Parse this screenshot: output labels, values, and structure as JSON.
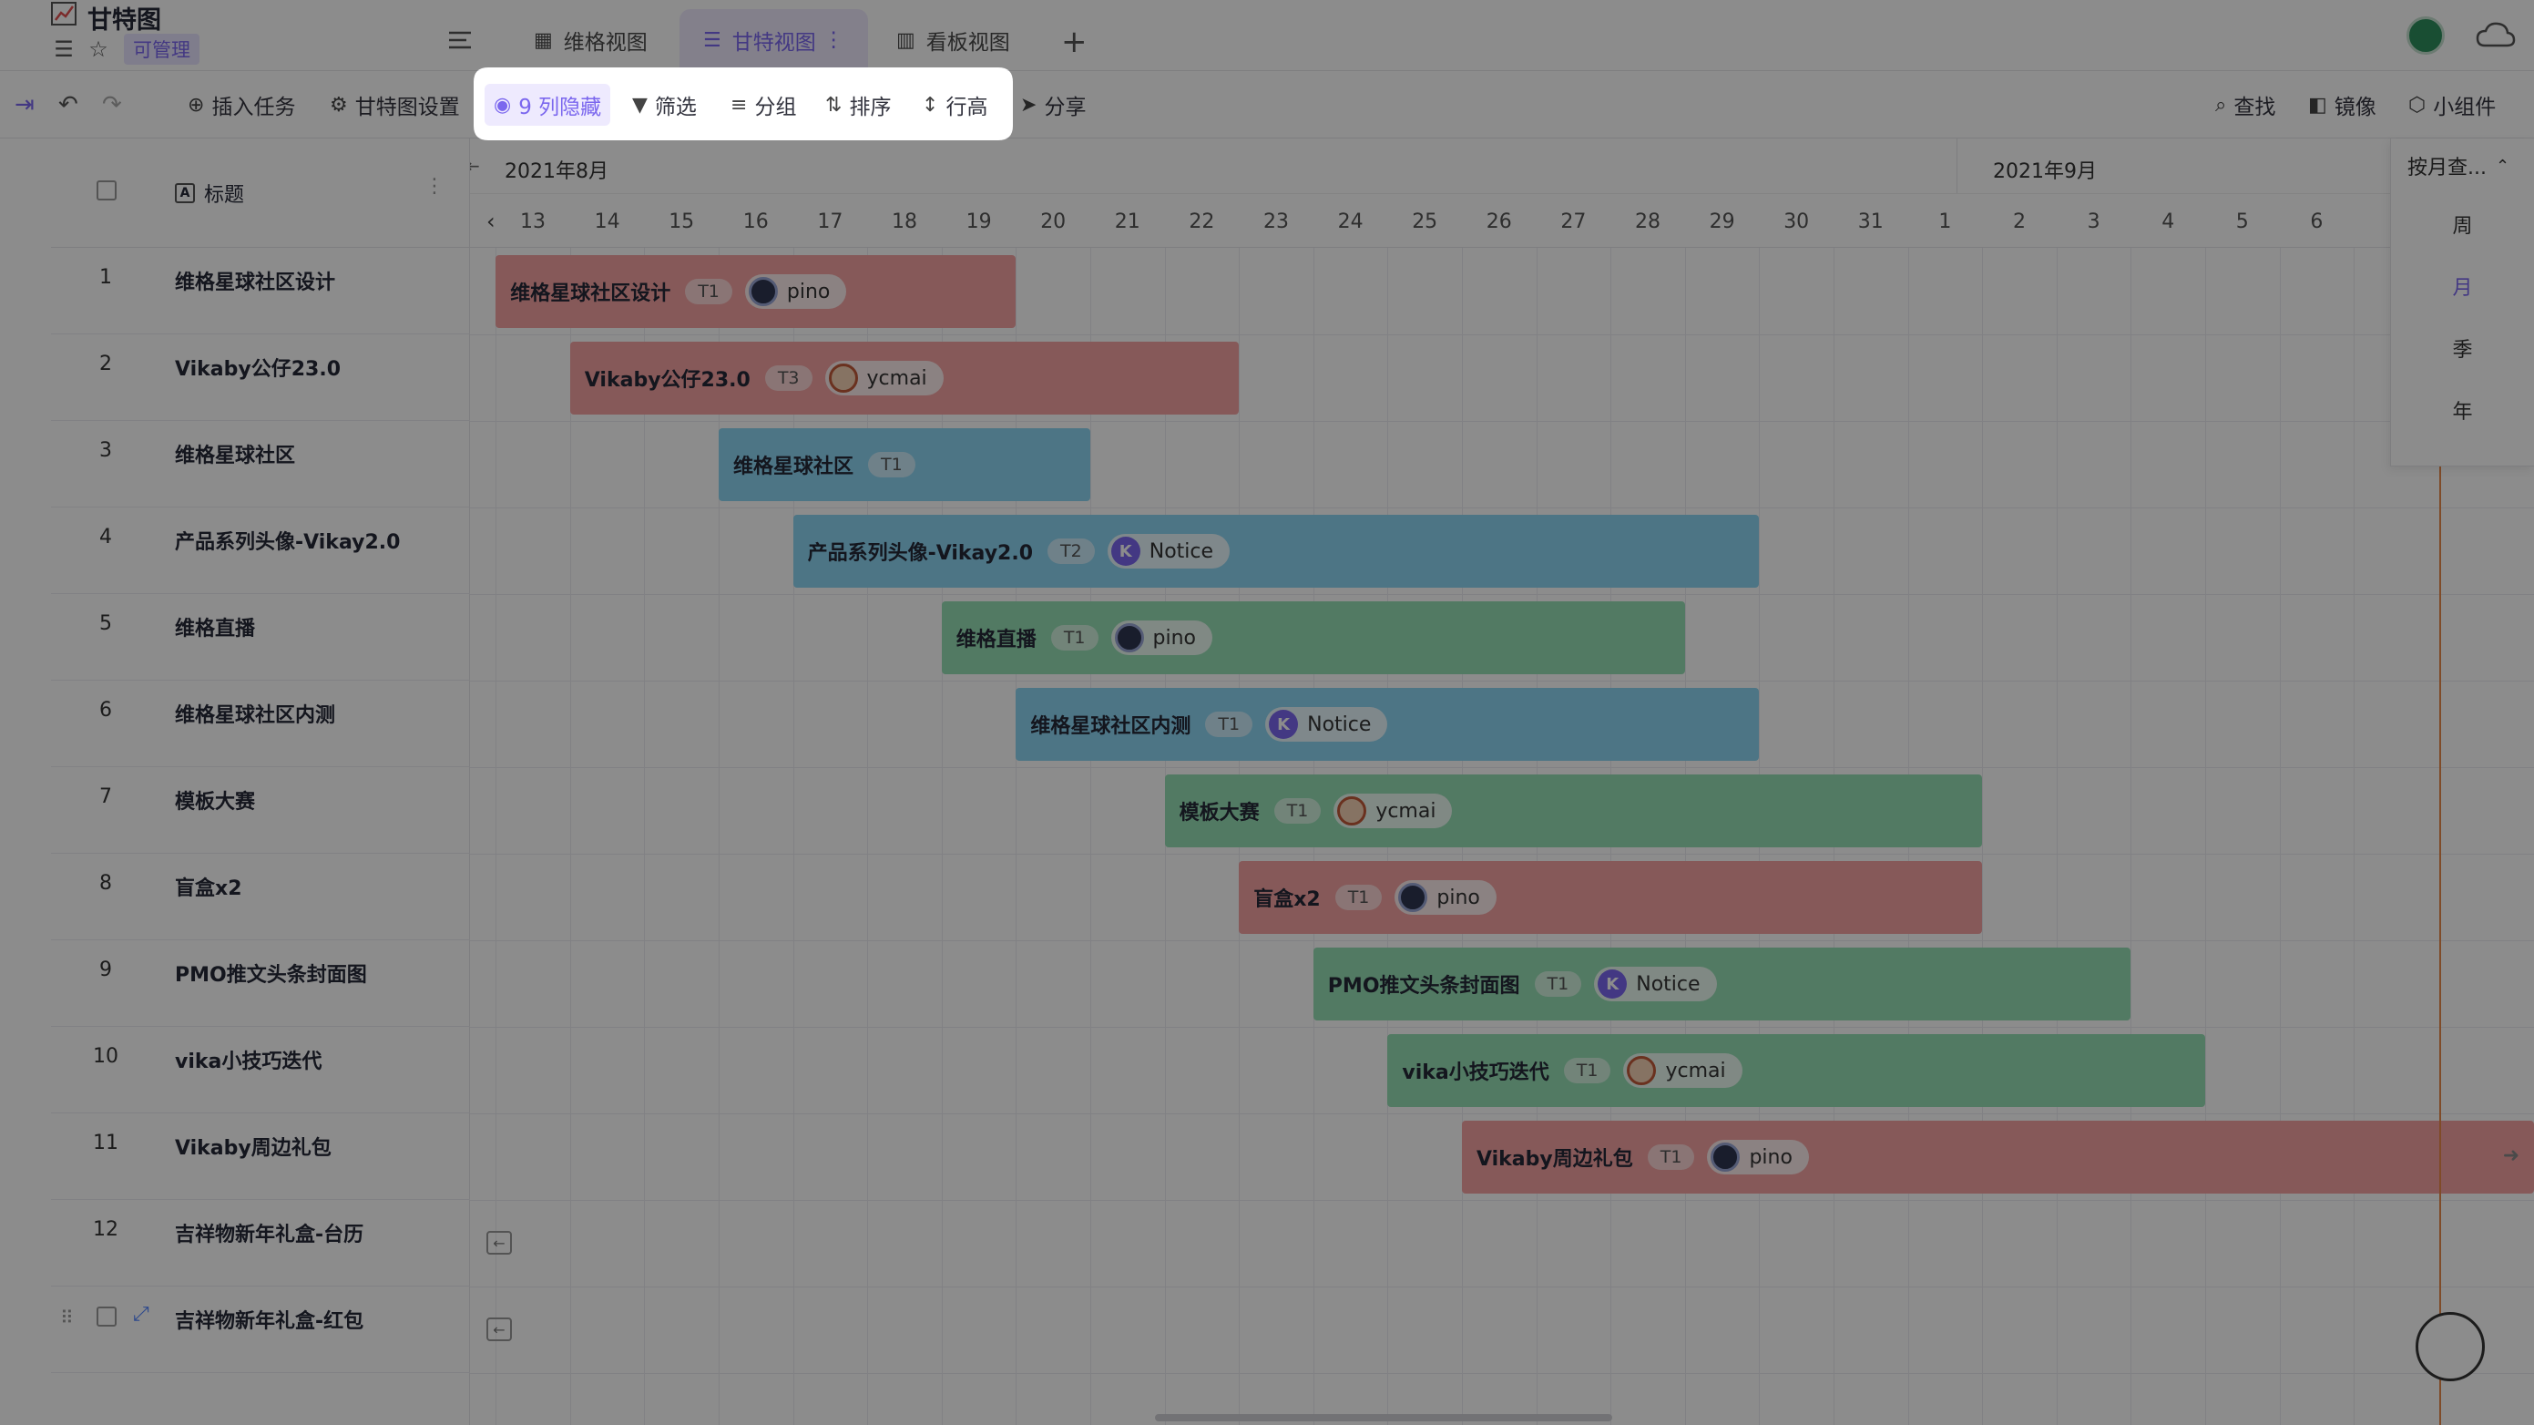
{
  "header": {
    "title": "甘特图",
    "permission_badge": "可管理",
    "tabs": [
      {
        "label": "维格视图",
        "icon": "grid-view-icon"
      },
      {
        "label": "甘特视图",
        "icon": "gantt-view-icon"
      },
      {
        "label": "看板视图",
        "icon": "kanban-view-icon"
      }
    ],
    "add_tab": "+"
  },
  "toolbar": {
    "insert_task": "插入任务",
    "gantt_settings": "甘特图设置",
    "hidden_columns": "9 列隐藏",
    "filter": "筛选",
    "group": "分组",
    "sort": "排序",
    "row_height": "行高",
    "share": "分享",
    "find": "查找",
    "mirror": "镜像",
    "widgets": "小组件"
  },
  "grid": {
    "column_title": "标题",
    "rows": [
      {
        "num": "1",
        "title": "维格星球社区设计"
      },
      {
        "num": "2",
        "title": "Vikaby公仔23.0"
      },
      {
        "num": "3",
        "title": "维格星球社区"
      },
      {
        "num": "4",
        "title": "产品系列头像-Vikay2.0"
      },
      {
        "num": "5",
        "title": "维格直播"
      },
      {
        "num": "6",
        "title": "维格星球社区内测"
      },
      {
        "num": "7",
        "title": "模板大赛"
      },
      {
        "num": "8",
        "title": "盲盒x2"
      },
      {
        "num": "9",
        "title": "PMO推文头条封面图"
      },
      {
        "num": "10",
        "title": "vika小技巧迭代"
      },
      {
        "num": "11",
        "title": "Vikaby周边礼包"
      },
      {
        "num": "12",
        "title": "吉祥物新年礼盒-台历"
      },
      {
        "num": "",
        "title": "吉祥物新年礼盒-红包"
      }
    ]
  },
  "timeline": {
    "month_aug": "2021年8月",
    "month_sep": "2021年9月",
    "days": [
      "13",
      "14",
      "15",
      "16",
      "17",
      "18",
      "19",
      "20",
      "21",
      "22",
      "23",
      "24",
      "25",
      "26",
      "27",
      "28",
      "29",
      "30",
      "31",
      "1",
      "2",
      "3",
      "4",
      "5",
      "6"
    ],
    "bars": [
      {
        "name": "维格星球社区设计",
        "tag": "T1",
        "member": "pino",
        "color": "red",
        "start": 0,
        "span": 7
      },
      {
        "name": "Vikaby公仔23.0",
        "tag": "T3",
        "member": "ycmai",
        "color": "red",
        "start": 1,
        "span": 9
      },
      {
        "name": "维格星球社区",
        "tag": "T1",
        "member": "",
        "color": "blue",
        "start": 3,
        "span": 5
      },
      {
        "name": "产品系列头像-Vikay2.0",
        "tag": "T2",
        "member": "Notice",
        "color": "blue",
        "start": 4,
        "span": 13
      },
      {
        "name": "维格直播",
        "tag": "T1",
        "member": "pino",
        "color": "green",
        "start": 6,
        "span": 10
      },
      {
        "name": "维格星球社区内测",
        "tag": "T1",
        "member": "Notice",
        "color": "blue",
        "start": 7,
        "span": 10
      },
      {
        "name": "模板大赛",
        "tag": "T1",
        "member": "ycmai",
        "color": "green",
        "start": 9,
        "span": 11
      },
      {
        "name": "盲盒x2",
        "tag": "T1",
        "member": "pino",
        "color": "red",
        "start": 10,
        "span": 10
      },
      {
        "name": "PMO推文头条封面图",
        "tag": "T1",
        "member": "Notice",
        "color": "green",
        "start": 11,
        "span": 11
      },
      {
        "name": "vika小技巧迭代",
        "tag": "T1",
        "member": "ycmai",
        "color": "green",
        "start": 12,
        "span": 11
      },
      {
        "name": "Vikaby周边礼包",
        "tag": "T1",
        "member": "pino",
        "color": "red",
        "start": 13,
        "span": 15
      }
    ]
  },
  "scale": {
    "current": "按月查...",
    "options": [
      "周",
      "月",
      "季",
      "年"
    ],
    "selected": "月"
  },
  "colors": {
    "accent": "#7b67ee",
    "bar_red": "#f5a3a3",
    "bar_blue": "#8cd6f2",
    "bar_green": "#95dfb4",
    "today_line": "#e8894a"
  }
}
